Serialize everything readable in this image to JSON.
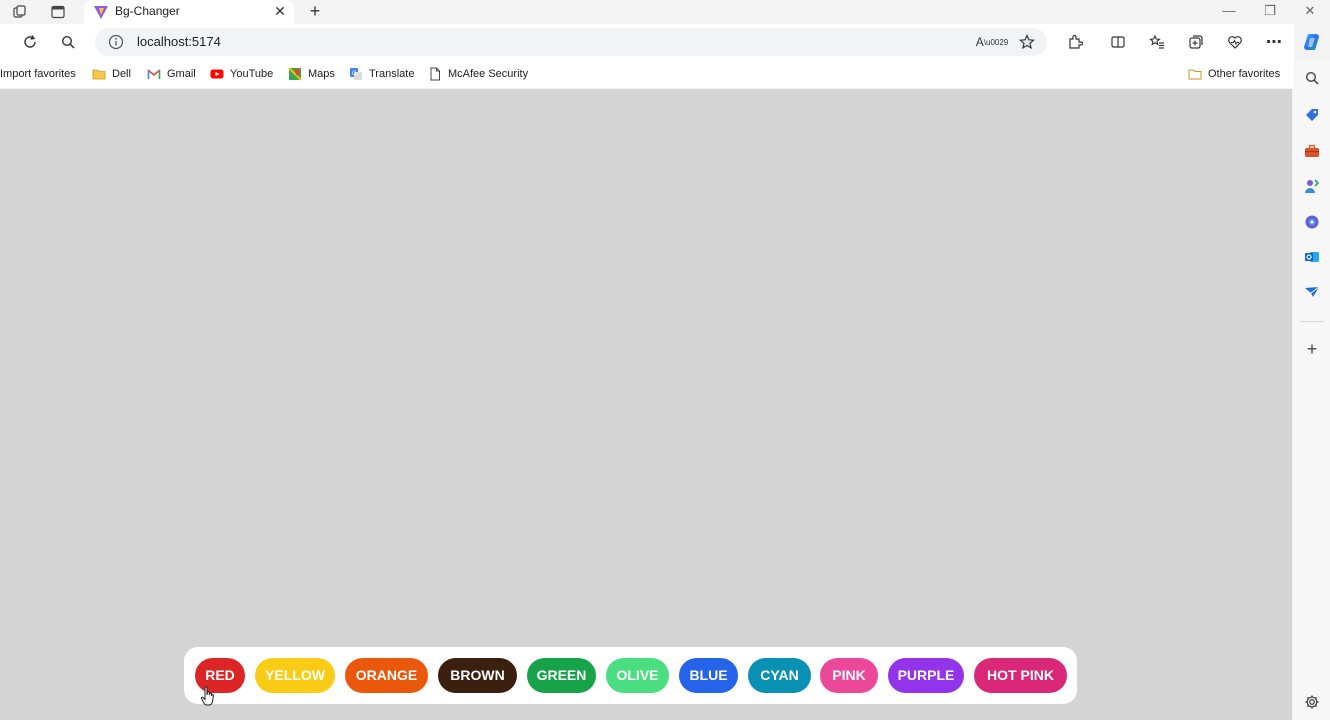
{
  "browser": {
    "tab": {
      "title": "Bg-Changer"
    },
    "address": {
      "url": "localhost:5174"
    },
    "favorites": [
      {
        "label": "Import favorites",
        "icon": "none"
      },
      {
        "label": "Dell",
        "icon": "folder-icon"
      },
      {
        "label": "Gmail",
        "icon": "gmail-icon"
      },
      {
        "label": "YouTube",
        "icon": "youtube-icon"
      },
      {
        "label": "Maps",
        "icon": "maps-icon"
      },
      {
        "label": "Translate",
        "icon": "translate-icon"
      },
      {
        "label": "McAfee Security",
        "icon": "page-icon"
      }
    ],
    "other_favorites": "Other favorites"
  },
  "app": {
    "background_color": "#d4d4d4",
    "buttons": [
      {
        "label": "RED",
        "color": "#dc2626"
      },
      {
        "label": "YELLOW",
        "color": "#facc15"
      },
      {
        "label": "ORANGE",
        "color": "#ea580c"
      },
      {
        "label": "BROWN",
        "color": "#3b1f0f"
      },
      {
        "label": "GREEN",
        "color": "#16a34a"
      },
      {
        "label": "OLIVE",
        "color": "#4ade80"
      },
      {
        "label": "BLUE",
        "color": "#2563eb"
      },
      {
        "label": "CYAN",
        "color": "#0891b2"
      },
      {
        "label": "PINK",
        "color": "#ec4899"
      },
      {
        "label": "PURPLE",
        "color": "#9333ea"
      },
      {
        "label": "HOT PINK",
        "color": "#db2777"
      }
    ]
  }
}
